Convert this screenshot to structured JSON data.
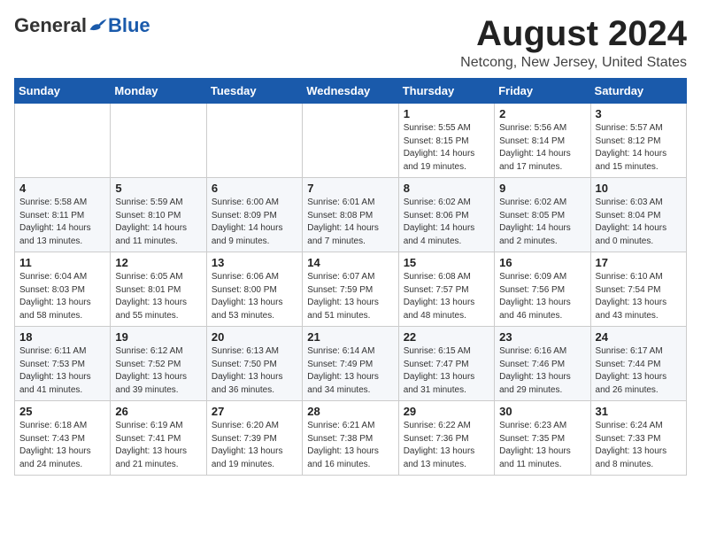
{
  "logo": {
    "general": "General",
    "blue": "Blue"
  },
  "title": "August 2024",
  "location": "Netcong, New Jersey, United States",
  "days_of_week": [
    "Sunday",
    "Monday",
    "Tuesday",
    "Wednesday",
    "Thursday",
    "Friday",
    "Saturday"
  ],
  "weeks": [
    [
      {
        "day": "",
        "detail": ""
      },
      {
        "day": "",
        "detail": ""
      },
      {
        "day": "",
        "detail": ""
      },
      {
        "day": "",
        "detail": ""
      },
      {
        "day": "1",
        "detail": "Sunrise: 5:55 AM\nSunset: 8:15 PM\nDaylight: 14 hours\nand 19 minutes."
      },
      {
        "day": "2",
        "detail": "Sunrise: 5:56 AM\nSunset: 8:14 PM\nDaylight: 14 hours\nand 17 minutes."
      },
      {
        "day": "3",
        "detail": "Sunrise: 5:57 AM\nSunset: 8:12 PM\nDaylight: 14 hours\nand 15 minutes."
      }
    ],
    [
      {
        "day": "4",
        "detail": "Sunrise: 5:58 AM\nSunset: 8:11 PM\nDaylight: 14 hours\nand 13 minutes."
      },
      {
        "day": "5",
        "detail": "Sunrise: 5:59 AM\nSunset: 8:10 PM\nDaylight: 14 hours\nand 11 minutes."
      },
      {
        "day": "6",
        "detail": "Sunrise: 6:00 AM\nSunset: 8:09 PM\nDaylight: 14 hours\nand 9 minutes."
      },
      {
        "day": "7",
        "detail": "Sunrise: 6:01 AM\nSunset: 8:08 PM\nDaylight: 14 hours\nand 7 minutes."
      },
      {
        "day": "8",
        "detail": "Sunrise: 6:02 AM\nSunset: 8:06 PM\nDaylight: 14 hours\nand 4 minutes."
      },
      {
        "day": "9",
        "detail": "Sunrise: 6:02 AM\nSunset: 8:05 PM\nDaylight: 14 hours\nand 2 minutes."
      },
      {
        "day": "10",
        "detail": "Sunrise: 6:03 AM\nSunset: 8:04 PM\nDaylight: 14 hours\nand 0 minutes."
      }
    ],
    [
      {
        "day": "11",
        "detail": "Sunrise: 6:04 AM\nSunset: 8:03 PM\nDaylight: 13 hours\nand 58 minutes."
      },
      {
        "day": "12",
        "detail": "Sunrise: 6:05 AM\nSunset: 8:01 PM\nDaylight: 13 hours\nand 55 minutes."
      },
      {
        "day": "13",
        "detail": "Sunrise: 6:06 AM\nSunset: 8:00 PM\nDaylight: 13 hours\nand 53 minutes."
      },
      {
        "day": "14",
        "detail": "Sunrise: 6:07 AM\nSunset: 7:59 PM\nDaylight: 13 hours\nand 51 minutes."
      },
      {
        "day": "15",
        "detail": "Sunrise: 6:08 AM\nSunset: 7:57 PM\nDaylight: 13 hours\nand 48 minutes."
      },
      {
        "day": "16",
        "detail": "Sunrise: 6:09 AM\nSunset: 7:56 PM\nDaylight: 13 hours\nand 46 minutes."
      },
      {
        "day": "17",
        "detail": "Sunrise: 6:10 AM\nSunset: 7:54 PM\nDaylight: 13 hours\nand 43 minutes."
      }
    ],
    [
      {
        "day": "18",
        "detail": "Sunrise: 6:11 AM\nSunset: 7:53 PM\nDaylight: 13 hours\nand 41 minutes."
      },
      {
        "day": "19",
        "detail": "Sunrise: 6:12 AM\nSunset: 7:52 PM\nDaylight: 13 hours\nand 39 minutes."
      },
      {
        "day": "20",
        "detail": "Sunrise: 6:13 AM\nSunset: 7:50 PM\nDaylight: 13 hours\nand 36 minutes."
      },
      {
        "day": "21",
        "detail": "Sunrise: 6:14 AM\nSunset: 7:49 PM\nDaylight: 13 hours\nand 34 minutes."
      },
      {
        "day": "22",
        "detail": "Sunrise: 6:15 AM\nSunset: 7:47 PM\nDaylight: 13 hours\nand 31 minutes."
      },
      {
        "day": "23",
        "detail": "Sunrise: 6:16 AM\nSunset: 7:46 PM\nDaylight: 13 hours\nand 29 minutes."
      },
      {
        "day": "24",
        "detail": "Sunrise: 6:17 AM\nSunset: 7:44 PM\nDaylight: 13 hours\nand 26 minutes."
      }
    ],
    [
      {
        "day": "25",
        "detail": "Sunrise: 6:18 AM\nSunset: 7:43 PM\nDaylight: 13 hours\nand 24 minutes."
      },
      {
        "day": "26",
        "detail": "Sunrise: 6:19 AM\nSunset: 7:41 PM\nDaylight: 13 hours\nand 21 minutes."
      },
      {
        "day": "27",
        "detail": "Sunrise: 6:20 AM\nSunset: 7:39 PM\nDaylight: 13 hours\nand 19 minutes."
      },
      {
        "day": "28",
        "detail": "Sunrise: 6:21 AM\nSunset: 7:38 PM\nDaylight: 13 hours\nand 16 minutes."
      },
      {
        "day": "29",
        "detail": "Sunrise: 6:22 AM\nSunset: 7:36 PM\nDaylight: 13 hours\nand 13 minutes."
      },
      {
        "day": "30",
        "detail": "Sunrise: 6:23 AM\nSunset: 7:35 PM\nDaylight: 13 hours\nand 11 minutes."
      },
      {
        "day": "31",
        "detail": "Sunrise: 6:24 AM\nSunset: 7:33 PM\nDaylight: 13 hours\nand 8 minutes."
      }
    ]
  ]
}
